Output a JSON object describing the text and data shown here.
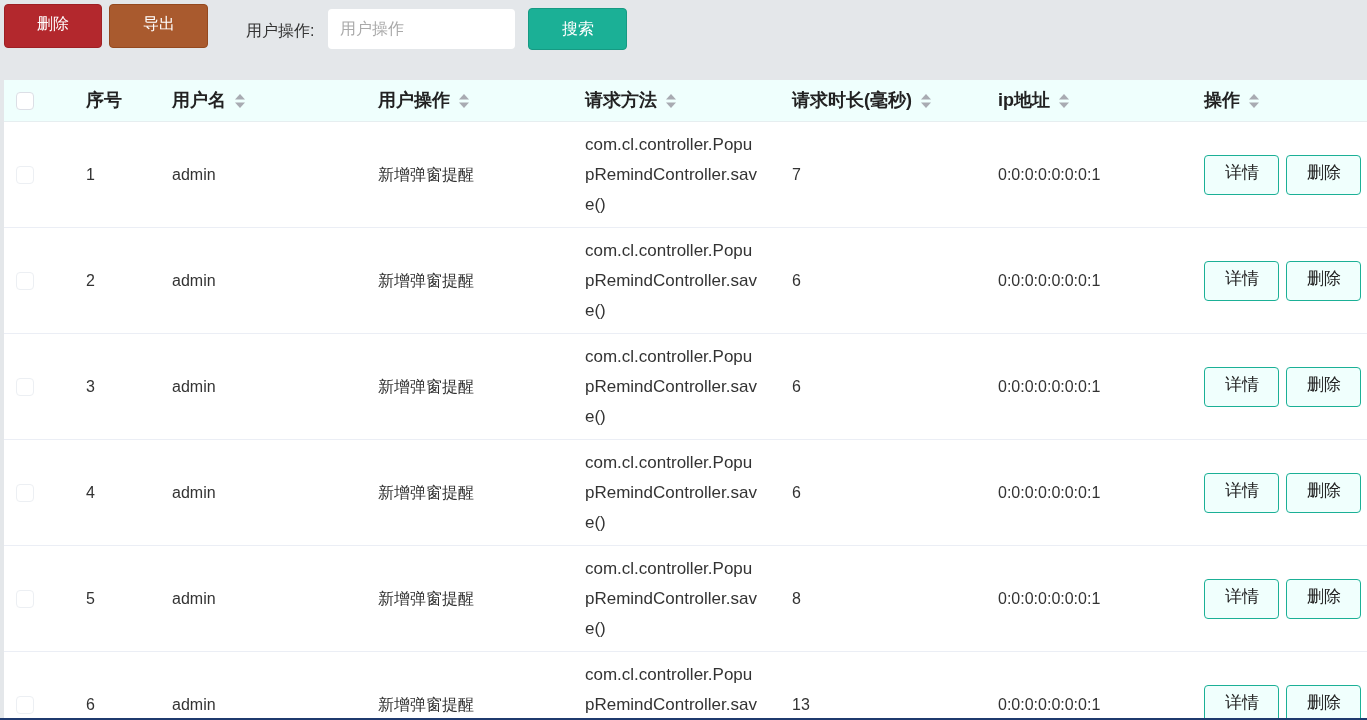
{
  "toolbar": {
    "delete_button": "删除",
    "export_button": "导出",
    "search_label": "用户操作:",
    "search_field": {
      "placeholder": "用户操作"
    },
    "search_button": "搜索"
  },
  "table": {
    "select_all": {
      "checked": false
    },
    "columns": [
      {
        "label": "序号",
        "sortable": false
      },
      {
        "label": "用户名",
        "sortable": true
      },
      {
        "label": "用户操作",
        "sortable": true
      },
      {
        "label": "请求方法",
        "sortable": true
      },
      {
        "label": "请求时长(毫秒)",
        "sortable": true
      },
      {
        "label": "ip地址",
        "sortable": true
      },
      {
        "label": "操作",
        "sortable": true
      }
    ],
    "rows": [
      {
        "checked": false,
        "index": "1",
        "username": "admin",
        "operation": "新增弹窗提醒",
        "method": "com.cl.controller.PopupRemindController.save()",
        "duration": "7",
        "ip": "0:0:0:0:0:0:0:1",
        "actions": [
          "详情",
          "删除"
        ]
      },
      {
        "checked": false,
        "index": "2",
        "username": "admin",
        "operation": "新增弹窗提醒",
        "method": "com.cl.controller.PopupRemindController.save()",
        "duration": "6",
        "ip": "0:0:0:0:0:0:0:1",
        "actions": [
          "详情",
          "删除"
        ]
      },
      {
        "checked": false,
        "index": "3",
        "username": "admin",
        "operation": "新增弹窗提醒",
        "method": "com.cl.controller.PopupRemindController.save()",
        "duration": "6",
        "ip": "0:0:0:0:0:0:0:1",
        "actions": [
          "详情",
          "删除"
        ]
      },
      {
        "checked": false,
        "index": "4",
        "username": "admin",
        "operation": "新增弹窗提醒",
        "method": "com.cl.controller.PopupRemindController.save()",
        "duration": "6",
        "ip": "0:0:0:0:0:0:0:1",
        "actions": [
          "详情",
          "删除"
        ]
      },
      {
        "checked": false,
        "index": "5",
        "username": "admin",
        "operation": "新增弹窗提醒",
        "method": "com.cl.controller.PopupRemindController.save()",
        "duration": "8",
        "ip": "0:0:0:0:0:0:0:1",
        "actions": [
          "详情",
          "删除"
        ]
      },
      {
        "checked": false,
        "index": "6",
        "username": "admin",
        "operation": "新增弹窗提醒",
        "method": "com.cl.controller.PopupRemindController.sav",
        "duration": "13",
        "ip": "0:0:0:0:0:0:0:1",
        "actions": [
          "详情",
          "删除"
        ]
      }
    ]
  }
}
